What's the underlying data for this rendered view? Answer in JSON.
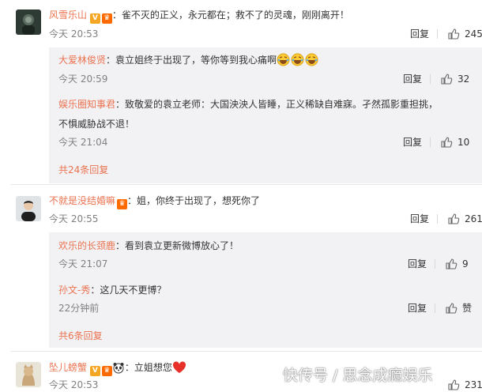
{
  "accent": "#eb7350",
  "reply_label": "回复",
  "comments": [
    {
      "user": "风雪乐山",
      "text": "：雀不灭的正义，永元都在；救不了的灵魂，刚刚离开！",
      "time": "今天 20:53",
      "likes": "245",
      "replies": [
        {
          "user": "大爱林俊贤",
          "text": "：袁立姐终于出现了，等你等到我心痛啊",
          "time": "今天 20:59",
          "likes": "32"
        },
        {
          "user": "娱乐圈知事君",
          "text": "：致敬爱的袁立老师：大国泱泱人皆睡，正义稀缺自难寐。孑然孤影重担挑，",
          "text2": "不惧威胁战不退！",
          "time": "今天 21:04",
          "likes": "10"
        }
      ],
      "more": "共24条回复"
    },
    {
      "user": "不就是没结婚嘛",
      "text": "：姐，你终于出现了，想死你了",
      "time": "今天 20:55",
      "likes": "261",
      "replies": [
        {
          "user": "欢乐的长颈鹿",
          "text": "：看到袁立更新微博放心了！",
          "time": "今天 21:07",
          "likes": "9"
        },
        {
          "user": "孙文-秀",
          "text": "：这几天不更博？",
          "time": "22分钟前",
          "likes": "赞"
        }
      ],
      "more": "共6条回复"
    },
    {
      "user": "坠儿螃蟹",
      "text": "：立姐想您",
      "time": "今天 20:53",
      "likes": "231"
    }
  ],
  "watermark": "快传号 / 思念成瘾娱乐"
}
